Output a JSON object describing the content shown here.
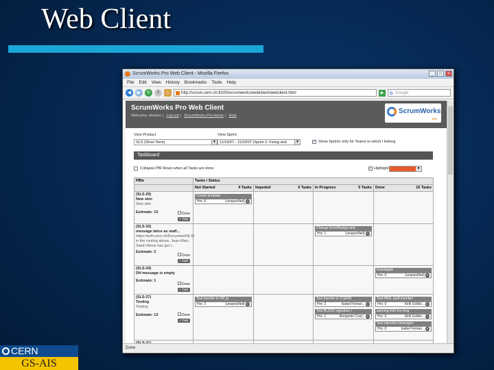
{
  "slide": {
    "title": "Web Client",
    "cern_label": "CERN",
    "dept_label": "GS-AIS"
  },
  "browser": {
    "window_title": "ScrumWorks Pro Web Client - Mozilla Firefox",
    "menu": [
      "File",
      "Edit",
      "View",
      "History",
      "Bookmarks",
      "Tools",
      "Help"
    ],
    "url": "http://scrum.cern.ch:8100/scrumworks/webclient/webclient.html",
    "search_placeholder": "Google",
    "status": "Done"
  },
  "app": {
    "title": "ScrumWorks Pro Web Client",
    "welcome": "Welcome: dnehes",
    "links": [
      "Log out",
      "ScrumWorks Pro Home",
      "Help"
    ],
    "logo_text": "ScrumWorks",
    "logo_sub": "pro",
    "view_product_label": "View Product",
    "view_product_value": "SLS (Short Term)",
    "view_sprint_label": "View Sprint",
    "view_sprint_value": "11/19/07 - 11/23/07 (Sprint 2: Fixing and",
    "show_sprints_label": "Show Sprints only for Teams to which I belong",
    "taskboard_label": "Taskboard",
    "collapse_label": "Collapse PBI Rows when all Tasks are done",
    "highlight_label": "Highlight My Tasks",
    "columns": {
      "pbis": "PBIs",
      "tasks_status": "Tasks / Status",
      "not_started": "Not Started",
      "not_started_count": "4 Tasks",
      "impeded": "Impeded",
      "impeded_count": "0 Tasks",
      "in_progress": "In Progress",
      "in_progress_count": "5 Tasks",
      "done": "Done",
      "done_count": "15 Tasks"
    },
    "done_label": "Done",
    "add_task_label": "+ Task",
    "rows": [
      {
        "id": "(SLS-29)",
        "title": "New skin",
        "desc": "New skin",
        "estimate": "Estimate: 13"
      },
      {
        "id": "(SLS-33)",
        "title": "message twice as staff...",
        "desc": "https://edh.cern.ch/Document/SLS/ in the routing above, Jean-Marc Saint-Viteux has got t...",
        "estimate": "Estimate: 3"
      },
      {
        "id": "(SLS-34)",
        "title": "DH message is empty",
        "desc": "",
        "estimate": "Estimate: 1"
      },
      {
        "id": "(SLS-27)",
        "title": "Testing",
        "desc": "Testing",
        "estimate": "Estimate: 13"
      },
      {
        "id": "(SLS-31)",
        "title": "",
        "desc": "",
        "estimate": ""
      }
    ],
    "cards": {
      "r1_ns": {
        "title": "Create template",
        "hrs": "Hrs: 6",
        "owner": "(unspecified)"
      },
      "r2_ip": {
        "title": "Change force/Resign and",
        "hrs": "Hrs: 1",
        "owner": "(unspecified)"
      },
      "r3_done": {
        "title": "Investigate",
        "hrs": "Hrs: 0",
        "owner": "(unspecified)"
      },
      "r4_ns": {
        "title": "Test transfer in HR pr",
        "hrs": "Hrs: 2",
        "owner": "(unspecified)"
      },
      "r4_ip1": {
        "title": "Test transfer in TCERN",
        "hrs": "Hrs: 2",
        "owner": "Isabel Feman..."
      },
      "r4_ip2": {
        "title": "Test BLOCK signature i",
        "hrs": "Hrs: 1",
        "owner": "Benjamin Cout..."
      },
      "r4_d1": {
        "title": "Test HRA, staff member",
        "hrs": "Hrs: 0",
        "owner": "Kirill Gollko..."
      },
      "r4_d2": {
        "title": "warning field too long",
        "hrs": "Hrs: 0",
        "owner": "Kirill Gollko..."
      },
      "r4_d3": {
        "title": "Test rejection messages",
        "hrs": "Hrs: 0",
        "owner": "Isabel Feman..."
      }
    }
  }
}
